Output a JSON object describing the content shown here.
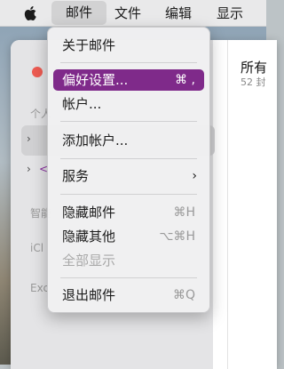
{
  "menubar": {
    "items": [
      "邮件",
      "文件",
      "编辑",
      "显示"
    ],
    "active_index": 0,
    "apple_icon": "apple-logo-icon"
  },
  "menu": {
    "items": [
      {
        "label": "关于邮件",
        "shortcut": ""
      },
      {
        "label": "偏好设置...",
        "shortcut": "⌘ ,",
        "selected": true
      },
      {
        "label": "帐户...",
        "shortcut": ""
      },
      {
        "label": "添加帐户...",
        "shortcut": ""
      },
      {
        "label": "服务",
        "shortcut": "",
        "submenu": true
      },
      {
        "label": "隐藏邮件",
        "shortcut": "⌘H"
      },
      {
        "label": "隐藏其他",
        "shortcut": "⌥⌘H"
      },
      {
        "label": "全部显示",
        "shortcut": "",
        "disabled": true
      },
      {
        "label": "退出邮件",
        "shortcut": "⌘Q"
      }
    ],
    "selected_color": "#7f2a8a"
  },
  "sidebar": {
    "section_personal": "个人",
    "section_smart": "智能",
    "section_icloud": "iCl",
    "section_exchange": "Exc"
  },
  "list": {
    "title": "所有",
    "subtitle": "52 封"
  }
}
